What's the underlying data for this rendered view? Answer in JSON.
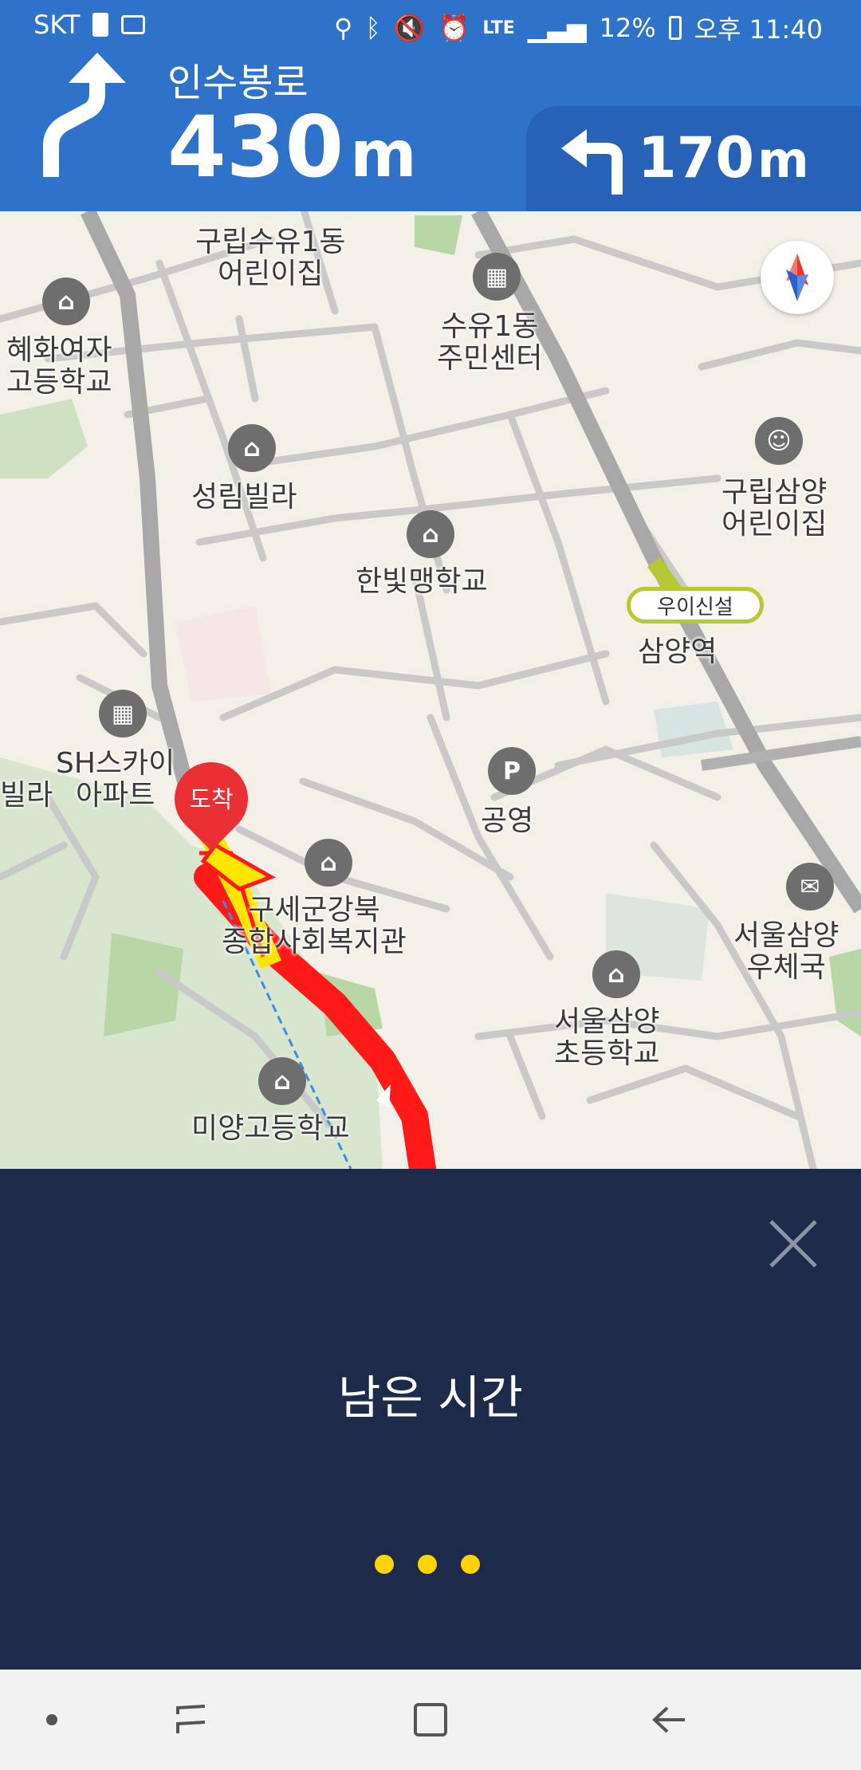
{
  "status_bar": {
    "carrier": "SKT",
    "network": "LTE",
    "battery": "12%",
    "time": "오후 11:40"
  },
  "navigation": {
    "street": "인수봉로",
    "distance_value": "430",
    "distance_unit": "m",
    "next_distance_value": "170",
    "next_distance_unit": "m"
  },
  "map": {
    "labels": {
      "daycare1": "구립수유1동\n어린이집",
      "community_center": "수유1동\n주민센터",
      "girls_hs": "혜화여자\n고등학교",
      "villa": "성림빌라",
      "daycare2": "구립삼양\n어린이집",
      "blind_school": "한빛맹학교",
      "station": "삼양역",
      "apartment": "SH스카이\n아파트",
      "villa_partial": "빌라",
      "parking": "공영",
      "welfare": "구세군강북\n종합사회복지관",
      "post_office": "서울삼양\n우체국",
      "elementary": "서울삼양\n초등학교",
      "high_school": "미양고등학교"
    },
    "station_badge": "우이신설",
    "destination": "도착",
    "parking_symbol": "P"
  },
  "panel": {
    "remaining_label": "남은 시간"
  },
  "colors": {
    "header": "#2e72c9",
    "panel": "#1e2a4a",
    "route": "#ff1a1a",
    "route_highlight": "#ffe600",
    "dots": "#ffd400"
  }
}
